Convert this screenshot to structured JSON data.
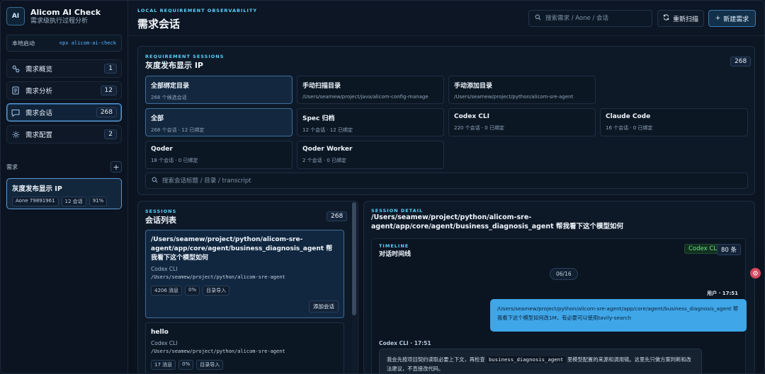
{
  "brand": {
    "logo": "AI",
    "title": "Alicom AI Check",
    "subtitle": "需求级执行过程分析"
  },
  "local": {
    "label": "本地启动",
    "command": "npx alicom-ai-check"
  },
  "nav": {
    "items": [
      {
        "label": "需求概览",
        "count": "1",
        "icon": "overview-icon"
      },
      {
        "label": "需求分析",
        "count": "12",
        "icon": "document-icon"
      },
      {
        "label": "需求会话",
        "count": "268",
        "icon": "chat-icon"
      },
      {
        "label": "需求配置",
        "count": "2",
        "icon": "settings-icon"
      }
    ]
  },
  "requirements": {
    "label": "需求",
    "add_label": "+",
    "card": {
      "title": "灰度发布显示 IP",
      "tags": [
        "Aone 79891961",
        "12 会话",
        "91%"
      ]
    }
  },
  "header": {
    "eyebrow": "LOCAL REQUIREMENT OBSERVABILITY",
    "title": "需求会话",
    "search_placeholder": "搜索需求 / Aone / 会话",
    "rescan_label": "重新扫描",
    "new_label": "新建需求"
  },
  "req_sessions": {
    "eyebrow": "REQUIREMENT SESSIONS",
    "title": "灰度发布显示 IP",
    "count": "268",
    "row1": [
      {
        "title": "全部绑定目录",
        "sub": "268 个候选会话"
      },
      {
        "title": "手动扫描目录",
        "sub": "/Users/seamew/project/java/alicom-config-manage"
      },
      {
        "title": "手动添加目录",
        "sub": "/Users/seamew/project/python/alicom-sre-agent"
      }
    ],
    "row2": [
      {
        "title": "全部",
        "sub": "268 个会话 · 12 已绑定"
      },
      {
        "title": "Spec 归档",
        "sub": "12 个会话 · 12 已绑定"
      },
      {
        "title": "Codex CLI",
        "sub": "220 个会话 · 0 已绑定"
      },
      {
        "title": "Claude Code",
        "sub": "16 个会话 · 0 已绑定"
      }
    ],
    "row3": [
      {
        "title": "Qoder",
        "sub": "18 个会话 · 0 已绑定"
      },
      {
        "title": "Qoder Worker",
        "sub": "2 个会话 · 0 已绑定"
      }
    ],
    "search_placeholder": "搜索会话标题 / 目录 / transcript"
  },
  "sessions": {
    "eyebrow": "SESSIONS",
    "title": "会话列表",
    "count": "268",
    "items": [
      {
        "title": "/Users/seamew/project/python/alicom-sre-agent/app/core/agent/business_diagnosis_agent 帮我看下这个模型如何",
        "source": "Codex CLI",
        "path": "/Users/seamew/project/python/alicom-sre-agent",
        "tags": [
          "4206 消息",
          "0%",
          "目录导入"
        ],
        "action": "添加会话"
      },
      {
        "title": "hello",
        "source": "Codex CLI",
        "path": "/Users/seamew/project/python/alicom-sre-agent",
        "tags": [
          "17 消息",
          "0%",
          "目录导入"
        ]
      }
    ]
  },
  "detail": {
    "eyebrow": "SESSION DETAIL",
    "title": "/Users/seamew/project/python/alicom-sre-agent/app/core/agent/business_diagnosis_agent 帮我看下这个模型如何",
    "timeline": {
      "eyebrow": "TIMELINE",
      "title": "对话时间线",
      "source": "Codex CLI",
      "count": "80 条",
      "date": "06/16",
      "user_meta": "用户 · 17:51",
      "user_text": "/Users/seamew/project/python/alicom-sre-agent/app/core/agent/business_diagnosis_agent 帮我看下这个模型如何改1M，有必要可以使用tavily-search",
      "assist_meta": "Codex CLI · 17:51",
      "assist_pre": "我会先按项目契约读取必要上下文，再检查",
      "assist_code": "business_diagnosis_agent",
      "assist_post": "里模型配置的来源和调用链。这里先只做方案判断和改法建议，不直接改代码。"
    }
  },
  "colors": {
    "accent": "#58d3ff",
    "active_border": "#5b9bd5",
    "user_bubble": "#3fa6e8",
    "codex_green": "#6fe38a"
  }
}
